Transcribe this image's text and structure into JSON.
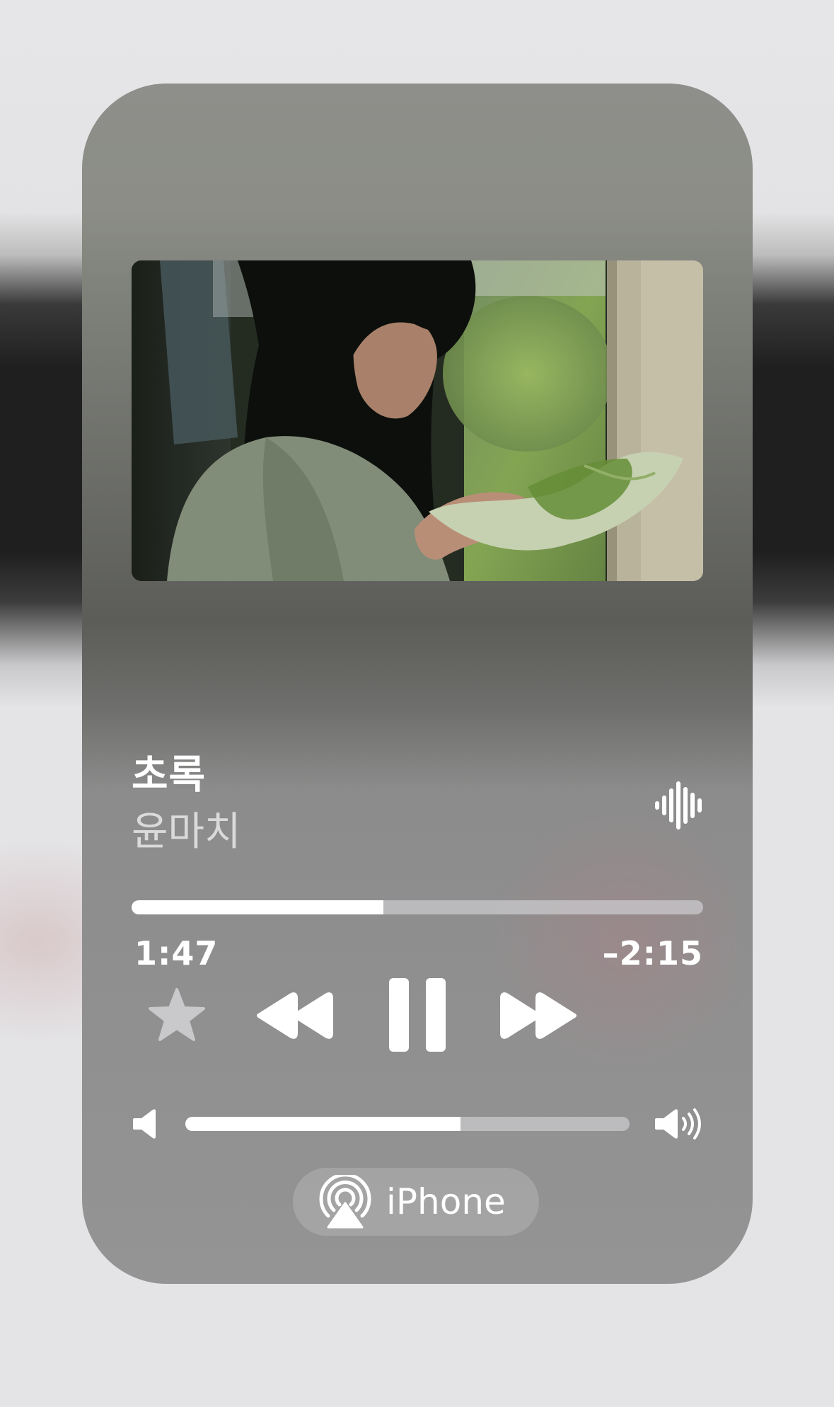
{
  "now_playing": {
    "title": "초록",
    "artist": "윤마치",
    "progress": {
      "elapsed": "1:47",
      "remaining": "–2:15",
      "fraction": 0.44
    },
    "volume": {
      "fraction": 0.62
    },
    "output_device": {
      "label": "iPhone",
      "icon": "airplay-icon"
    }
  },
  "icons": {
    "waveform": "waveform-icon",
    "favorite": "star-icon",
    "rewind": "rewind-icon",
    "pause": "pause-icon",
    "forward": "fast-forward-icon",
    "volume_low": "speaker-low-icon",
    "volume_high": "speaker-high-icon"
  },
  "colors": {
    "foreground": "#ffffff",
    "track": "#d2d2d6"
  }
}
